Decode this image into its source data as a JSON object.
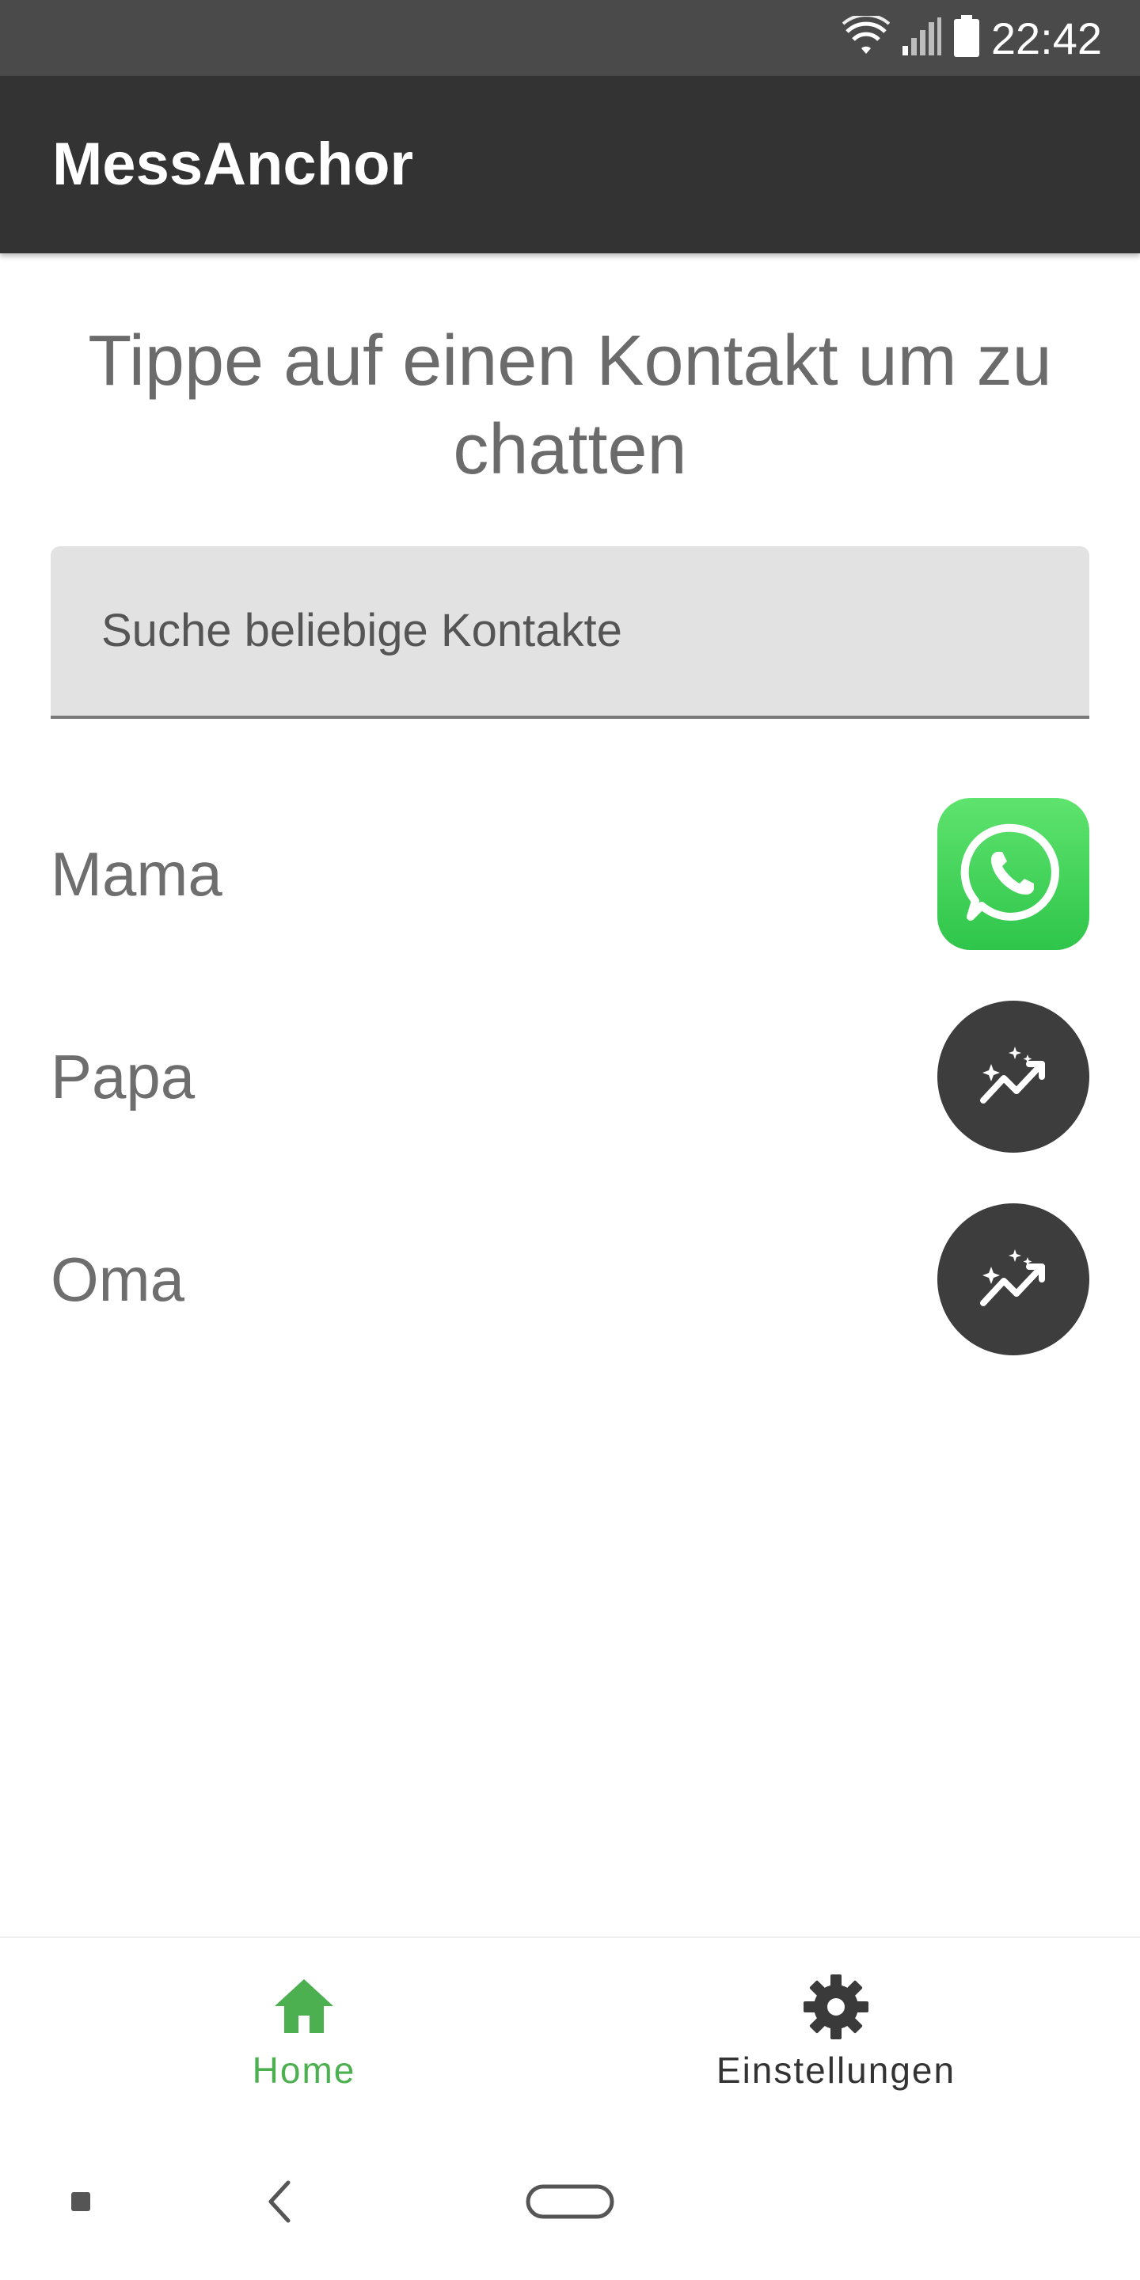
{
  "status_bar": {
    "time": "22:42",
    "icons": [
      "wifi-icon",
      "signal-icon",
      "battery-icon"
    ]
  },
  "app_bar": {
    "title": "MessAnchor"
  },
  "main": {
    "heading": "Tippe auf einen Kontakt um zu chatten",
    "search": {
      "placeholder": "Suche beliebige Kontakte"
    },
    "contacts": [
      {
        "name": "Mama",
        "action_icon": "whatsapp-icon"
      },
      {
        "name": "Papa",
        "action_icon": "sparkle-chart-icon"
      },
      {
        "name": "Oma",
        "action_icon": "sparkle-chart-icon"
      }
    ]
  },
  "bottom_nav": {
    "items": [
      {
        "label": "Home",
        "icon": "home-icon",
        "active": true
      },
      {
        "label": "Einstellungen",
        "icon": "gear-icon",
        "active": false
      }
    ]
  },
  "colors": {
    "status_bar_bg": "#4a4a4a",
    "app_bar_bg": "#333333",
    "accent_active": "#4caf50",
    "whatsapp_green": "#2fc54b",
    "action_button_bg": "#3d3d3d",
    "text_secondary": "#6e6e6e"
  }
}
